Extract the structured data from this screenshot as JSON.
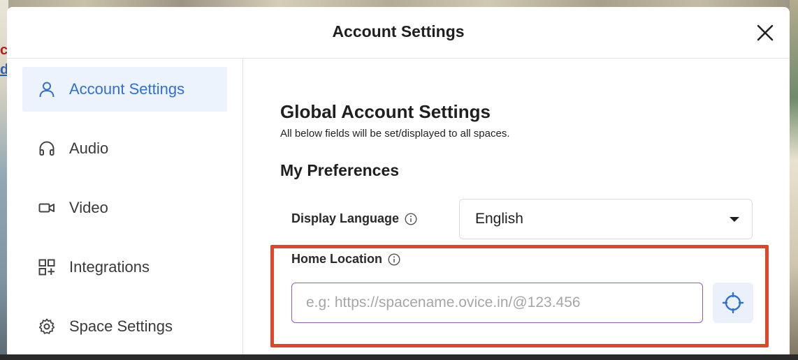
{
  "modal": {
    "title": "Account Settings"
  },
  "sidebar": {
    "items": [
      {
        "label": "Account Settings",
        "icon": "user-icon",
        "active": true
      },
      {
        "label": "Audio",
        "icon": "headphones-icon",
        "active": false
      },
      {
        "label": "Video",
        "icon": "video-camera-icon",
        "active": false
      },
      {
        "label": "Integrations",
        "icon": "grid-plus-icon",
        "active": false
      },
      {
        "label": "Space Settings",
        "icon": "gear-icon",
        "active": false
      }
    ]
  },
  "content": {
    "section_title": "Global Account Settings",
    "section_subtitle": "All below fields will be set/displayed to all spaces.",
    "prefs_title": "My Preferences",
    "display_language": {
      "label": "Display Language",
      "value": "English"
    },
    "home_location": {
      "label": "Home Location",
      "value": "",
      "placeholder": "e.g: https://spacename.ovice.in/@123.456"
    }
  },
  "colors": {
    "accent": "#2f6fd6",
    "active_bg": "#edf3fc",
    "highlight": "#e5432a",
    "input_focus": "#8e5ad0"
  }
}
